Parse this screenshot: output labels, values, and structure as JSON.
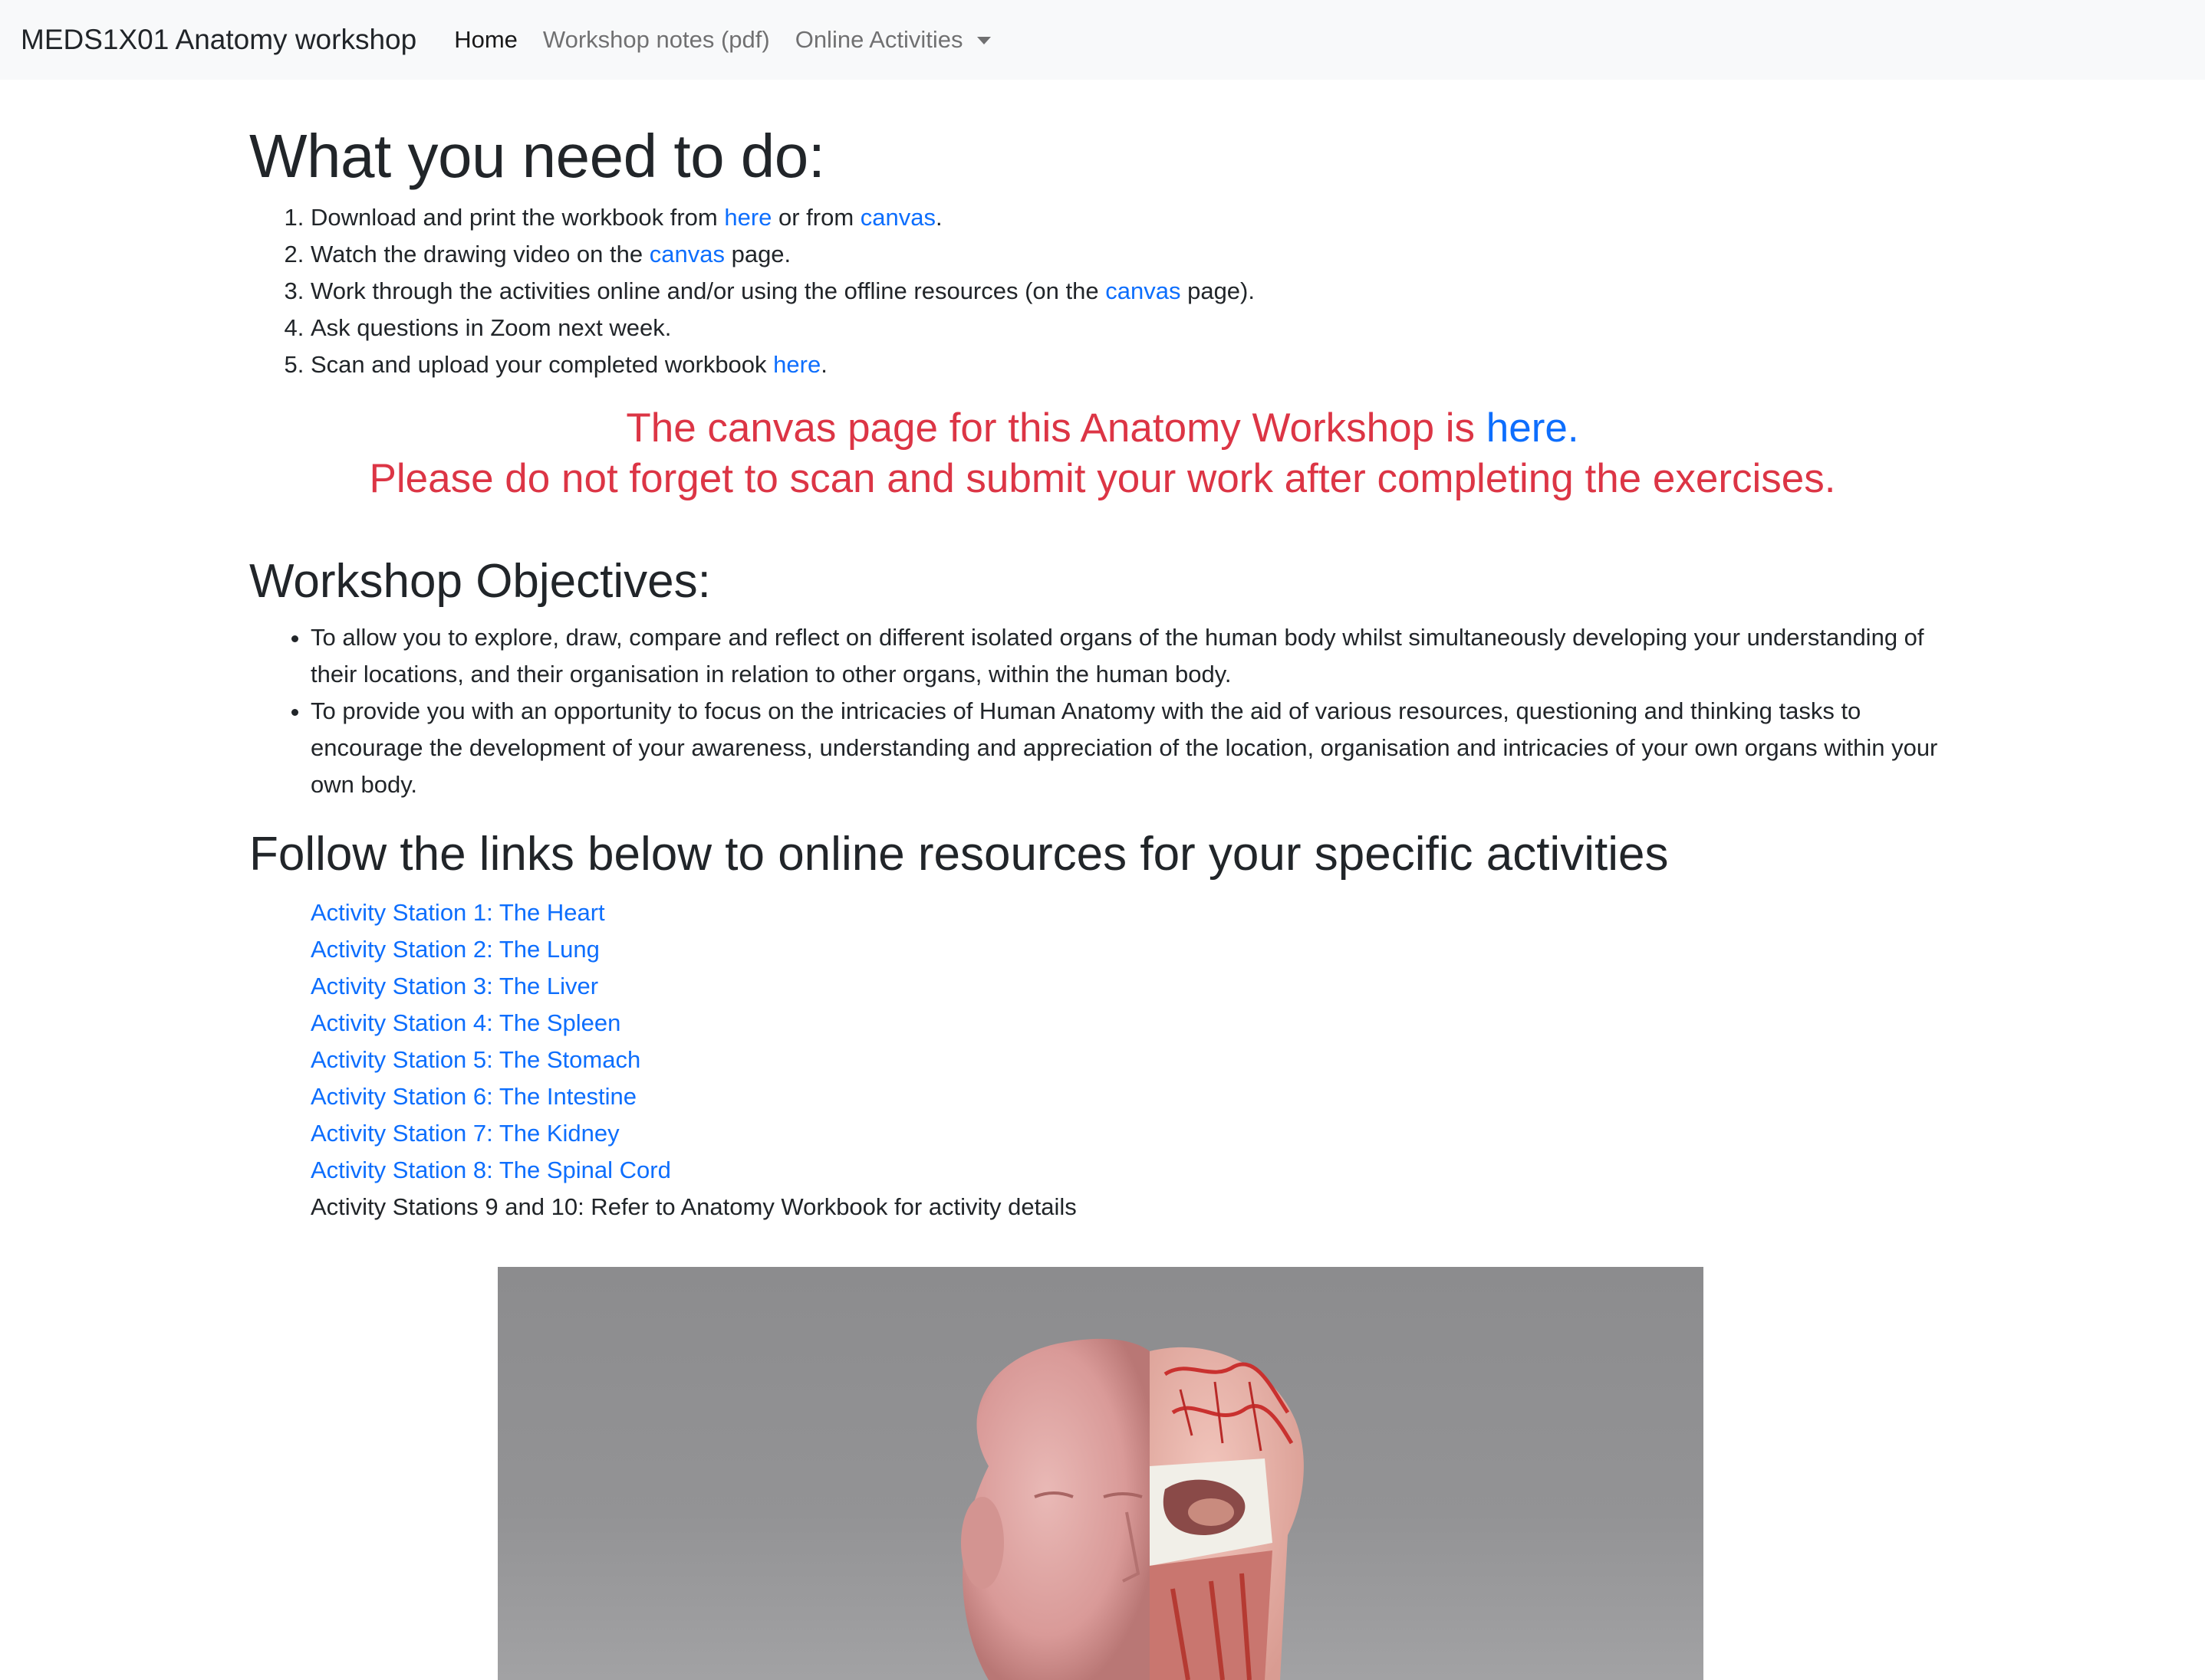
{
  "navbar": {
    "brand": "MEDS1X01 Anatomy workshop",
    "items": [
      {
        "label": "Home",
        "active": true
      },
      {
        "label": "Workshop notes (pdf)",
        "active": false
      },
      {
        "label": "Online Activities",
        "active": false,
        "dropdown": true
      }
    ]
  },
  "todo": {
    "heading": "What you need to do:",
    "steps": [
      {
        "before": "Download and print the workbook from ",
        "link1": "here",
        "middle": " or from ",
        "link2": "canvas",
        "after": "."
      },
      {
        "before": "Watch the drawing video on the ",
        "link1": "canvas",
        "after": " page."
      },
      {
        "before": "Work through the activities online and/or using the offline resources (on the ",
        "link1": "canvas",
        "after": " page)."
      },
      {
        "text": "Ask questions in Zoom next week."
      },
      {
        "before": "Scan and upload your completed workbook ",
        "link1": "here",
        "after": "."
      }
    ]
  },
  "notice": {
    "line1_before": "The canvas page for this Anatomy Workshop is ",
    "line1_link": "here.",
    "line2": "Please do not forget to scan and submit your work after completing the exercises.",
    "color": "#dc3545"
  },
  "objectives": {
    "heading": "Workshop Objectives:",
    "items": [
      "To allow you to explore, draw, compare and reflect on different isolated organs of the human body whilst simultaneously developing your understanding of their locations, and their organisation in relation to other organs, within the human body.",
      "To provide you with an opportunity to focus on the intricacies of Human Anatomy with the aid of various resources, questioning and thinking tasks to encourage the development of your awareness, understanding and appreciation of the location, organisation and intricacies of your own organs within your own body."
    ]
  },
  "activities": {
    "heading": "Follow the links below to online resources for your specific activities",
    "links": [
      "Activity Station 1: The Heart",
      "Activity Station 2: The Lung",
      "Activity Station 3: The Liver",
      "Activity Station 4: The Spleen",
      "Activity Station 5: The Stomach",
      "Activity Station 6: The Intestine",
      "Activity Station 7: The Kidney",
      "Activity Station 8: The Spinal Cord"
    ],
    "note": "Activity Stations 9 and 10: Refer to Anatomy Workbook for activity details"
  },
  "colors": {
    "link": "#0d6efd",
    "text": "#212529",
    "navbar_bg": "#f8f9fa"
  }
}
